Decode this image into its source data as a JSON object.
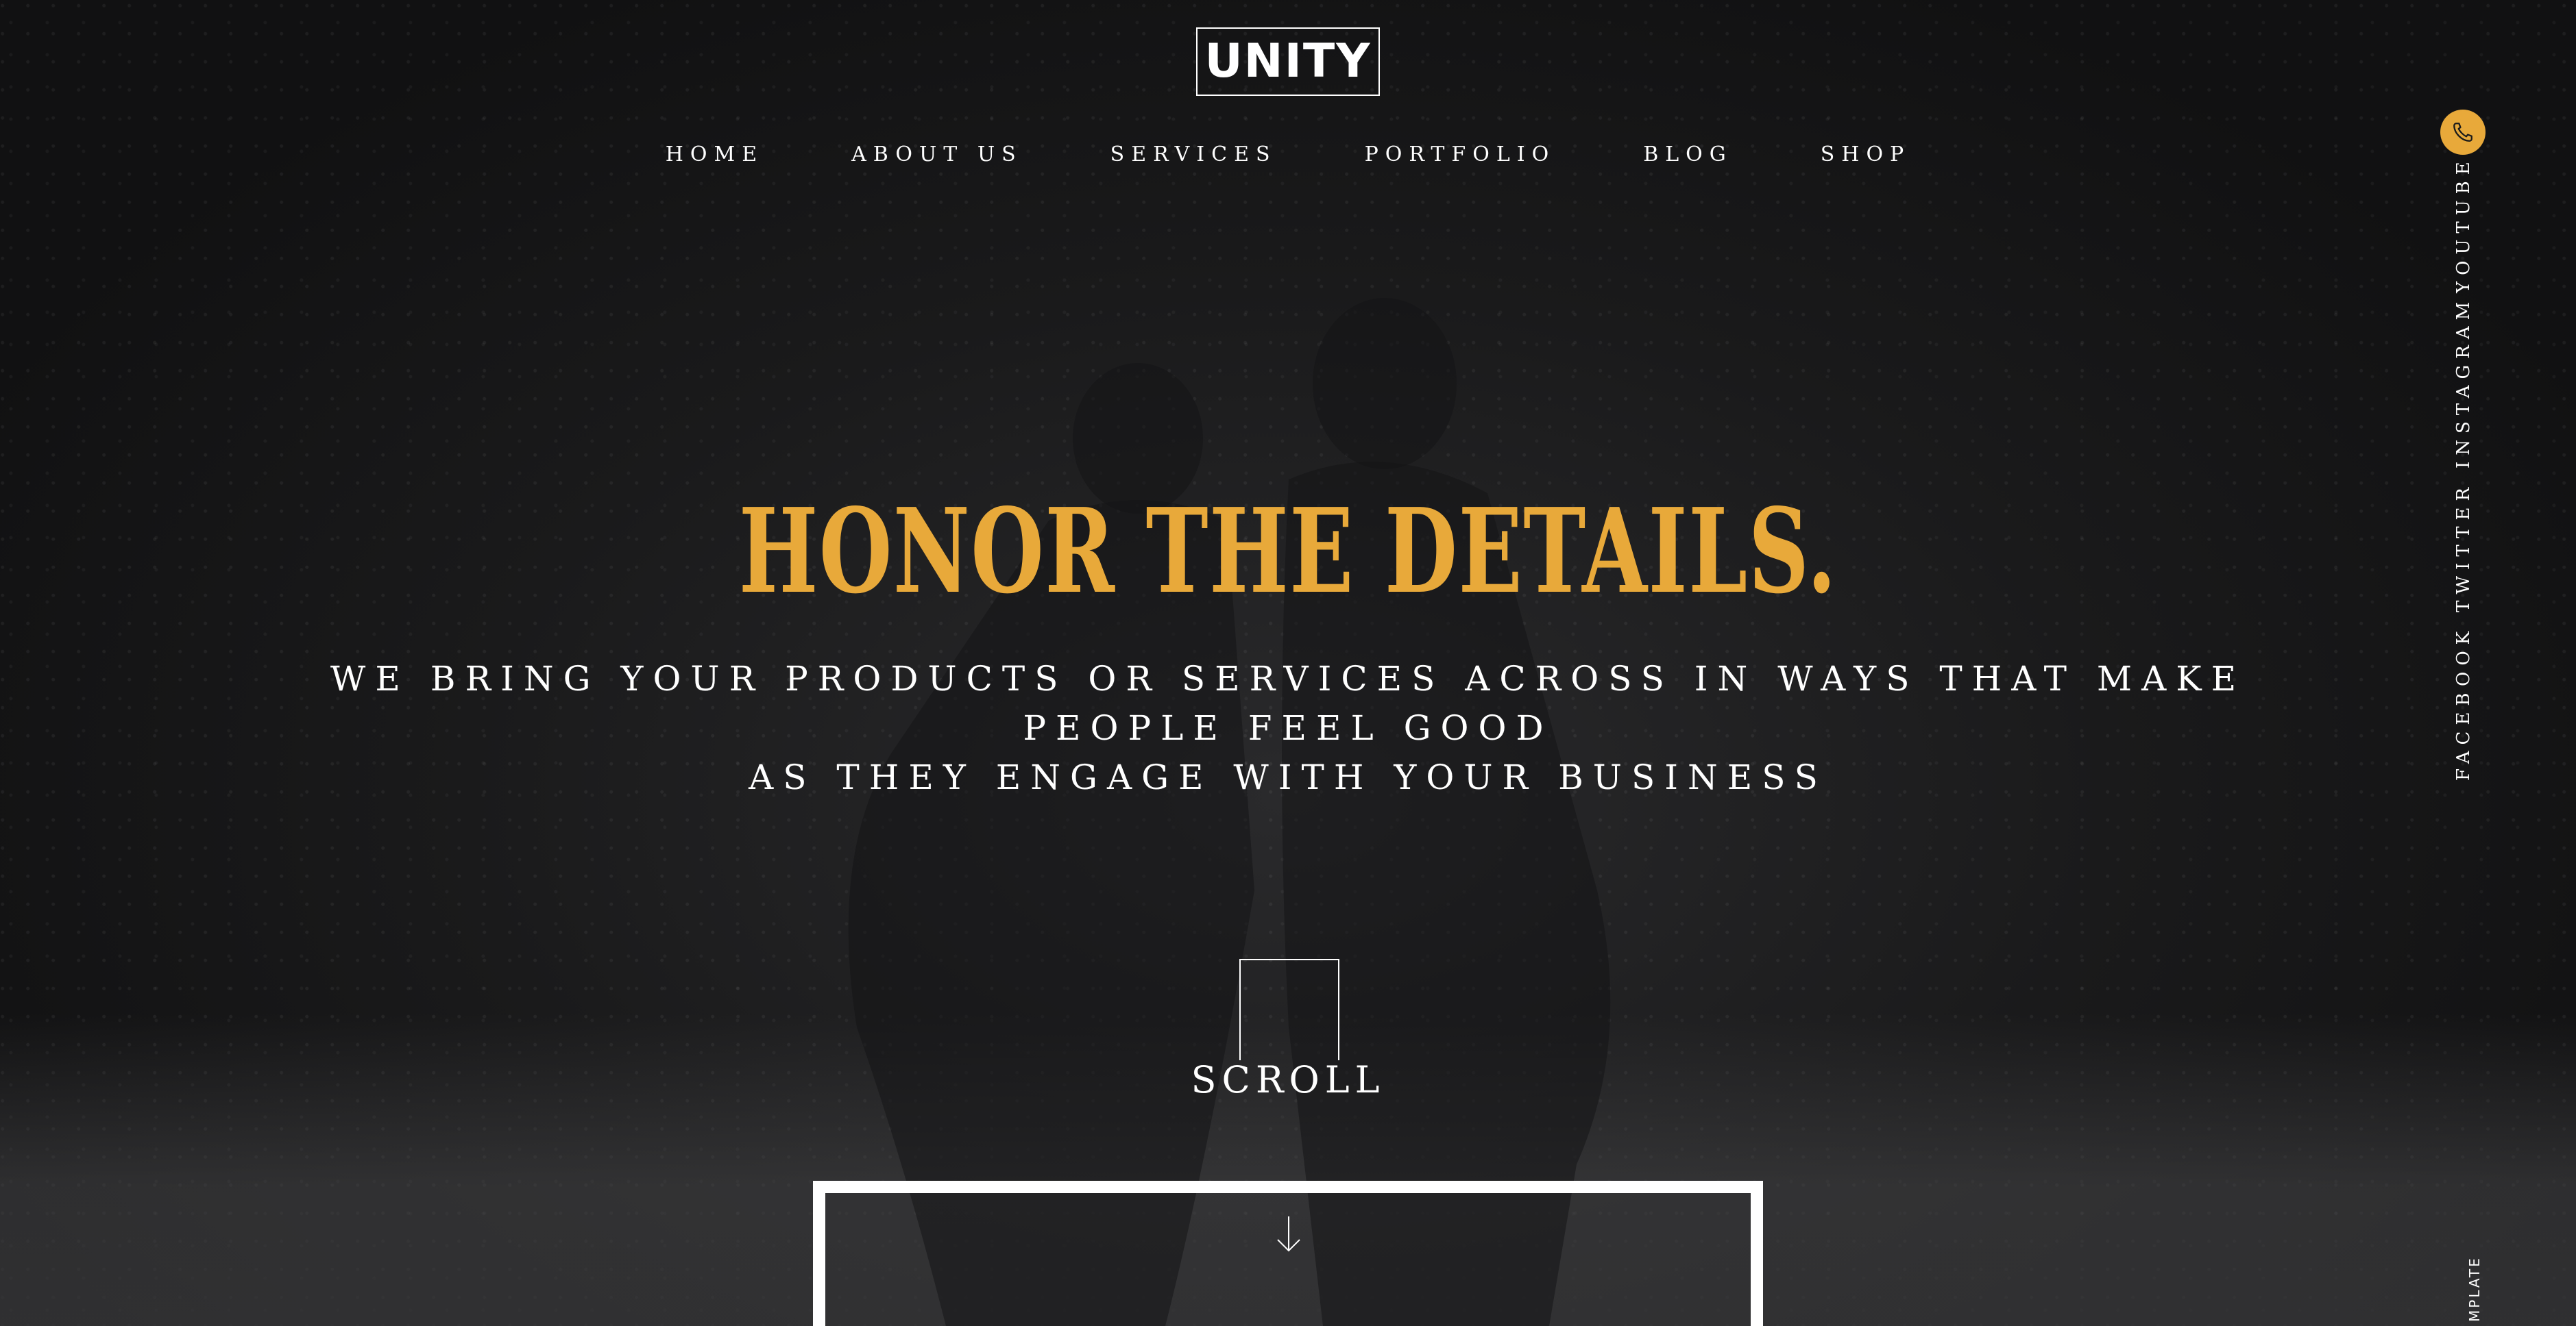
{
  "brand": {
    "logo_text": "UNITY"
  },
  "nav": {
    "items": [
      {
        "label": "HOME"
      },
      {
        "label": "ABOUT US"
      },
      {
        "label": "SERVICES"
      },
      {
        "label": "PORTFOLIO"
      },
      {
        "label": "BLOG"
      },
      {
        "label": "SHOP"
      }
    ]
  },
  "hero": {
    "title": "HONOR THE DETAILS.",
    "subtitle_line1": "WE BRING YOUR PRODUCTS OR SERVICES ACROSS IN WAYS THAT MAKE PEOPLE FEEL GOOD",
    "subtitle_line2": "AS THEY ENGAGE WITH YOUR BUSINESS",
    "scroll_label": "SCROLL"
  },
  "sidebar": {
    "social": [
      {
        "label": "YOUTUBE"
      },
      {
        "label": "INSTAGRAM"
      },
      {
        "label": "TWITTER"
      },
      {
        "label": "FACEBOOK"
      }
    ],
    "template_text": "MPLATE"
  },
  "icons": {
    "phone": "phone-icon",
    "down_arrow": "arrow-down-icon"
  },
  "colors": {
    "accent": "#e8a93a",
    "background": "#121213",
    "text": "#ffffff"
  }
}
